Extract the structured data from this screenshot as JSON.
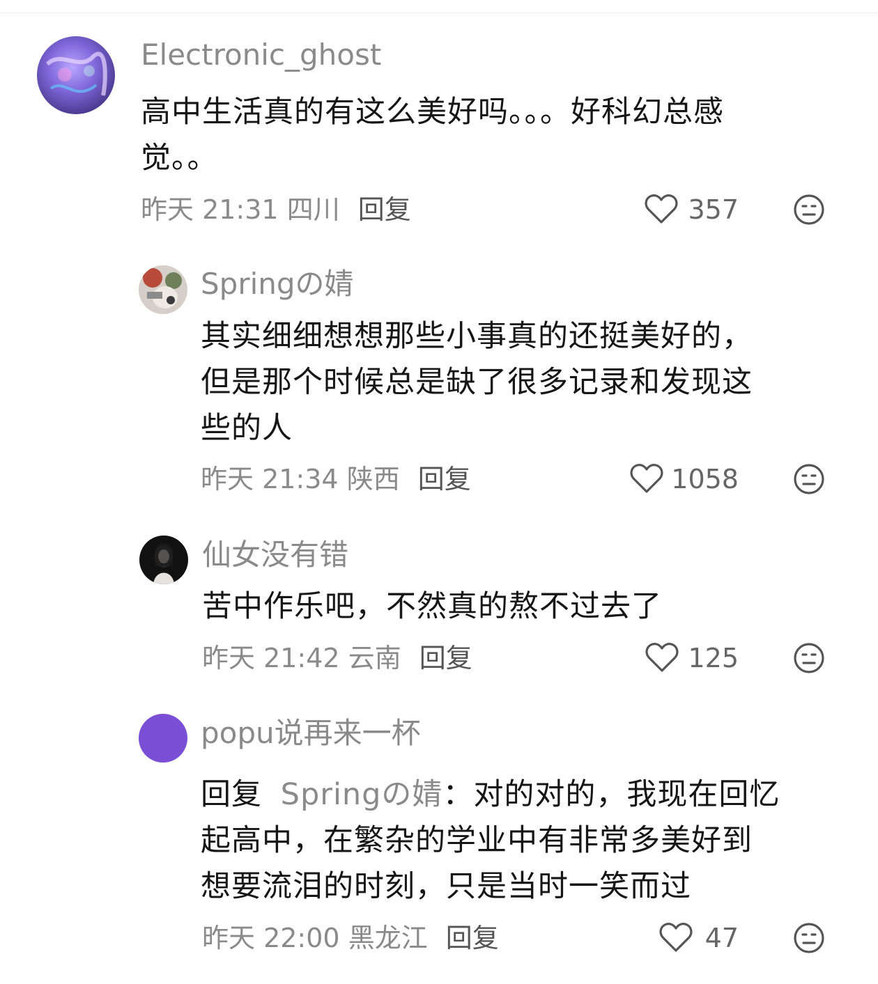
{
  "comments": [
    {
      "username": "Electronic_ghost",
      "content_lines": [
        "高中生活真的有这么美好吗。。。好科幻总感",
        "觉。。"
      ],
      "time": "昨天 21:31",
      "location": "四川",
      "reply_label": "回复",
      "likes": "357"
    },
    {
      "username": "Springの婧",
      "content_lines": [
        "其实细细想想那些小事真的还挺美好的，",
        "但是那个时候总是缺了很多记录和发现这",
        "些的人"
      ],
      "time": "昨天 21:34",
      "location": "陕西",
      "reply_label": "回复",
      "likes": "1058"
    },
    {
      "username": "仙女没有错",
      "content_lines": [
        "苦中作乐吧，不然真的熬不过去了"
      ],
      "time": "昨天 21:42",
      "location": "云南",
      "reply_label": "回复",
      "likes": "125"
    },
    {
      "username": "popu说再来一杯",
      "reply_prefix": "回复",
      "reply_to": "Springの婧",
      "reply_colon": "：",
      "content_first": "对的对的，我现在回忆",
      "content_lines": [
        "起高中，在繁杂的学业中有非常多美好到",
        "想要流泪的时刻，只是当时一笑而过"
      ],
      "time": "昨天 22:00",
      "location": "黑龙江",
      "reply_label": "回复",
      "likes": "47"
    }
  ],
  "colors": {
    "meta_gray": "#8a8a8a",
    "text_black": "#161616",
    "avatar_purple": "#7a4fd6"
  },
  "icons": [
    "heart-outline-icon",
    "neutral-face-icon"
  ]
}
